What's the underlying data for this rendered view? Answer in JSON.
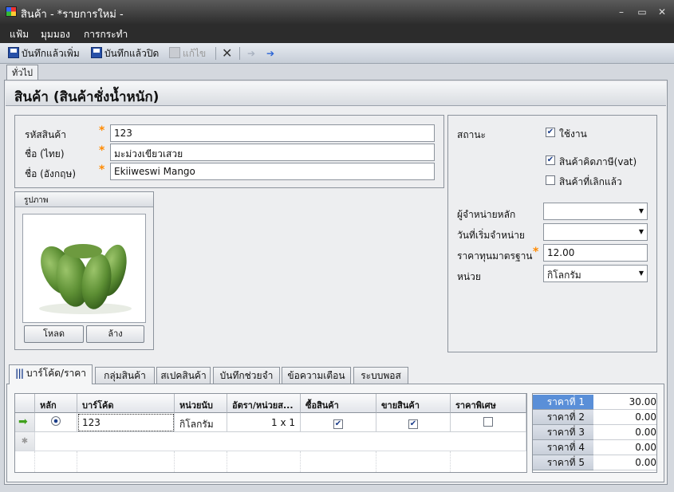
{
  "window": {
    "title": "สินค้า - *รายการใหม่ -",
    "controls": {
      "minimize": "–",
      "maximize": "▭",
      "close": "✕"
    }
  },
  "menu": [
    "แฟ้ม",
    "มุมมอง",
    "การกระทำ"
  ],
  "toolbar": {
    "save_new": "บันทึกแล้วเพิ่ม",
    "save_close": "บันทึกแล้วปิด",
    "undo": "แก้ไข"
  },
  "top_tab": "ทั่วไป",
  "page_title": "สินค้า (สินค้าชั่งน้ำหนัก)",
  "fields": {
    "code_label": "รหัสสินค้า",
    "code_value": "123",
    "name_th_label": "ชื่อ (ไทย)",
    "name_th_value": "มะม่วงเขียวเสวย",
    "name_en_label": "ชื่อ (อังกฤษ)",
    "name_en_value": "Ekiiweswi Mango",
    "required_mark": "*"
  },
  "image_panel": {
    "title": "รูปภาพ",
    "load_button": "โหลด",
    "clear_button": "ล้าง"
  },
  "status_panel": {
    "status_label": "สถานะ",
    "active_label": "ใช้งาน",
    "active_checked": true,
    "vat_label": "สินค้าคิดภาษี(vat)",
    "vat_checked": true,
    "discontinued_label": "สินค้าที่เลิกแล้ว",
    "discontinued_checked": false,
    "supplier_label": "ผู้จำหน่ายหลัก",
    "supplier_value": "",
    "start_date_label": "วันที่เริ่มจำหน่าย",
    "start_date_value": "",
    "std_cost_label": "ราคาทุนมาตรฐาน",
    "std_cost_value": "12.00",
    "unit_label": "หน่วย",
    "unit_value": "กิโลกรัม"
  },
  "bottom_tabs": [
    "บาร์โค้ด/ราคา",
    "กลุ่มสินค้า",
    "สเปคสินค้า",
    "บันทึกช่วยจำ",
    "ข้อความเตือน",
    "ระบบพอส"
  ],
  "barcode_grid": {
    "headers": [
      "หลัก",
      "บาร์โค้ด",
      "หน่วยนับ",
      "อัตรา/หน่วยส...",
      "ซื้อสินค้า",
      "ขายสินค้า",
      "ราคาพิเศษ"
    ],
    "rows": [
      {
        "primary": true,
        "barcode": "123",
        "unit": "กิโลกรัม",
        "rate": "1 x 1",
        "buy": true,
        "sell": true,
        "special": false
      }
    ],
    "new_row_marker": "✱"
  },
  "prices": [
    {
      "label": "ราคาที่ 1",
      "value": "30.00"
    },
    {
      "label": "ราคาที่ 2",
      "value": "0.00"
    },
    {
      "label": "ราคาที่ 3",
      "value": "0.00"
    },
    {
      "label": "ราคาที่ 4",
      "value": "0.00"
    },
    {
      "label": "ราคาที่ 5",
      "value": "0.00"
    }
  ],
  "colors": {
    "required": "#ff8a00",
    "selected_price": "#5a8fd8",
    "titlebar": "#3d3d3d"
  }
}
